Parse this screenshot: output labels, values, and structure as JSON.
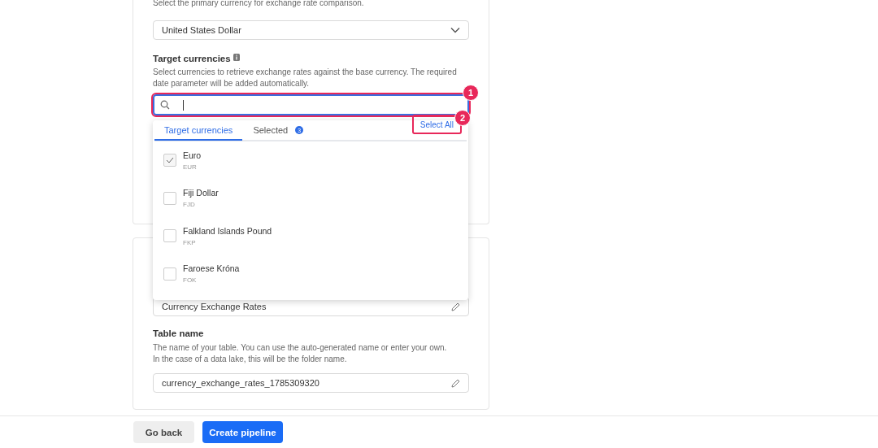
{
  "base_currency": {
    "description": "Select the primary currency for exchange rate comparison.",
    "value": "United States Dollar"
  },
  "target_currencies": {
    "label": "Target currencies",
    "description": "Select currencies to retrieve exchange rates against the base currency. The required date parameter will be added automatically.",
    "tabs": [
      {
        "label": "Target currencies",
        "selected": true
      },
      {
        "label": "Selected",
        "selected": false,
        "count": "3"
      }
    ],
    "select_all": "Select All",
    "options": [
      {
        "name": "Euro",
        "code": "EUR",
        "checked": true
      },
      {
        "name": "Fiji Dollar",
        "code": "FJD",
        "checked": false
      },
      {
        "name": "Falkland Islands Pound",
        "code": "FKP",
        "checked": false
      },
      {
        "name": "Faroese Króna",
        "code": "FOK",
        "checked": false
      }
    ]
  },
  "pipeline_name": {
    "value": "Currency Exchange Rates"
  },
  "table_name": {
    "label": "Table name",
    "description": [
      "The name of your table. You can use the auto-generated name or enter your own.",
      "In the case of a data lake, this will be the folder name."
    ],
    "value": "currency_exchange_rates_1785309320"
  },
  "annotations": [
    "1",
    "2"
  ],
  "buttons": [
    {
      "label": "Go back",
      "kind": "secondary"
    },
    {
      "label": "Create pipeline",
      "kind": "primary"
    }
  ]
}
